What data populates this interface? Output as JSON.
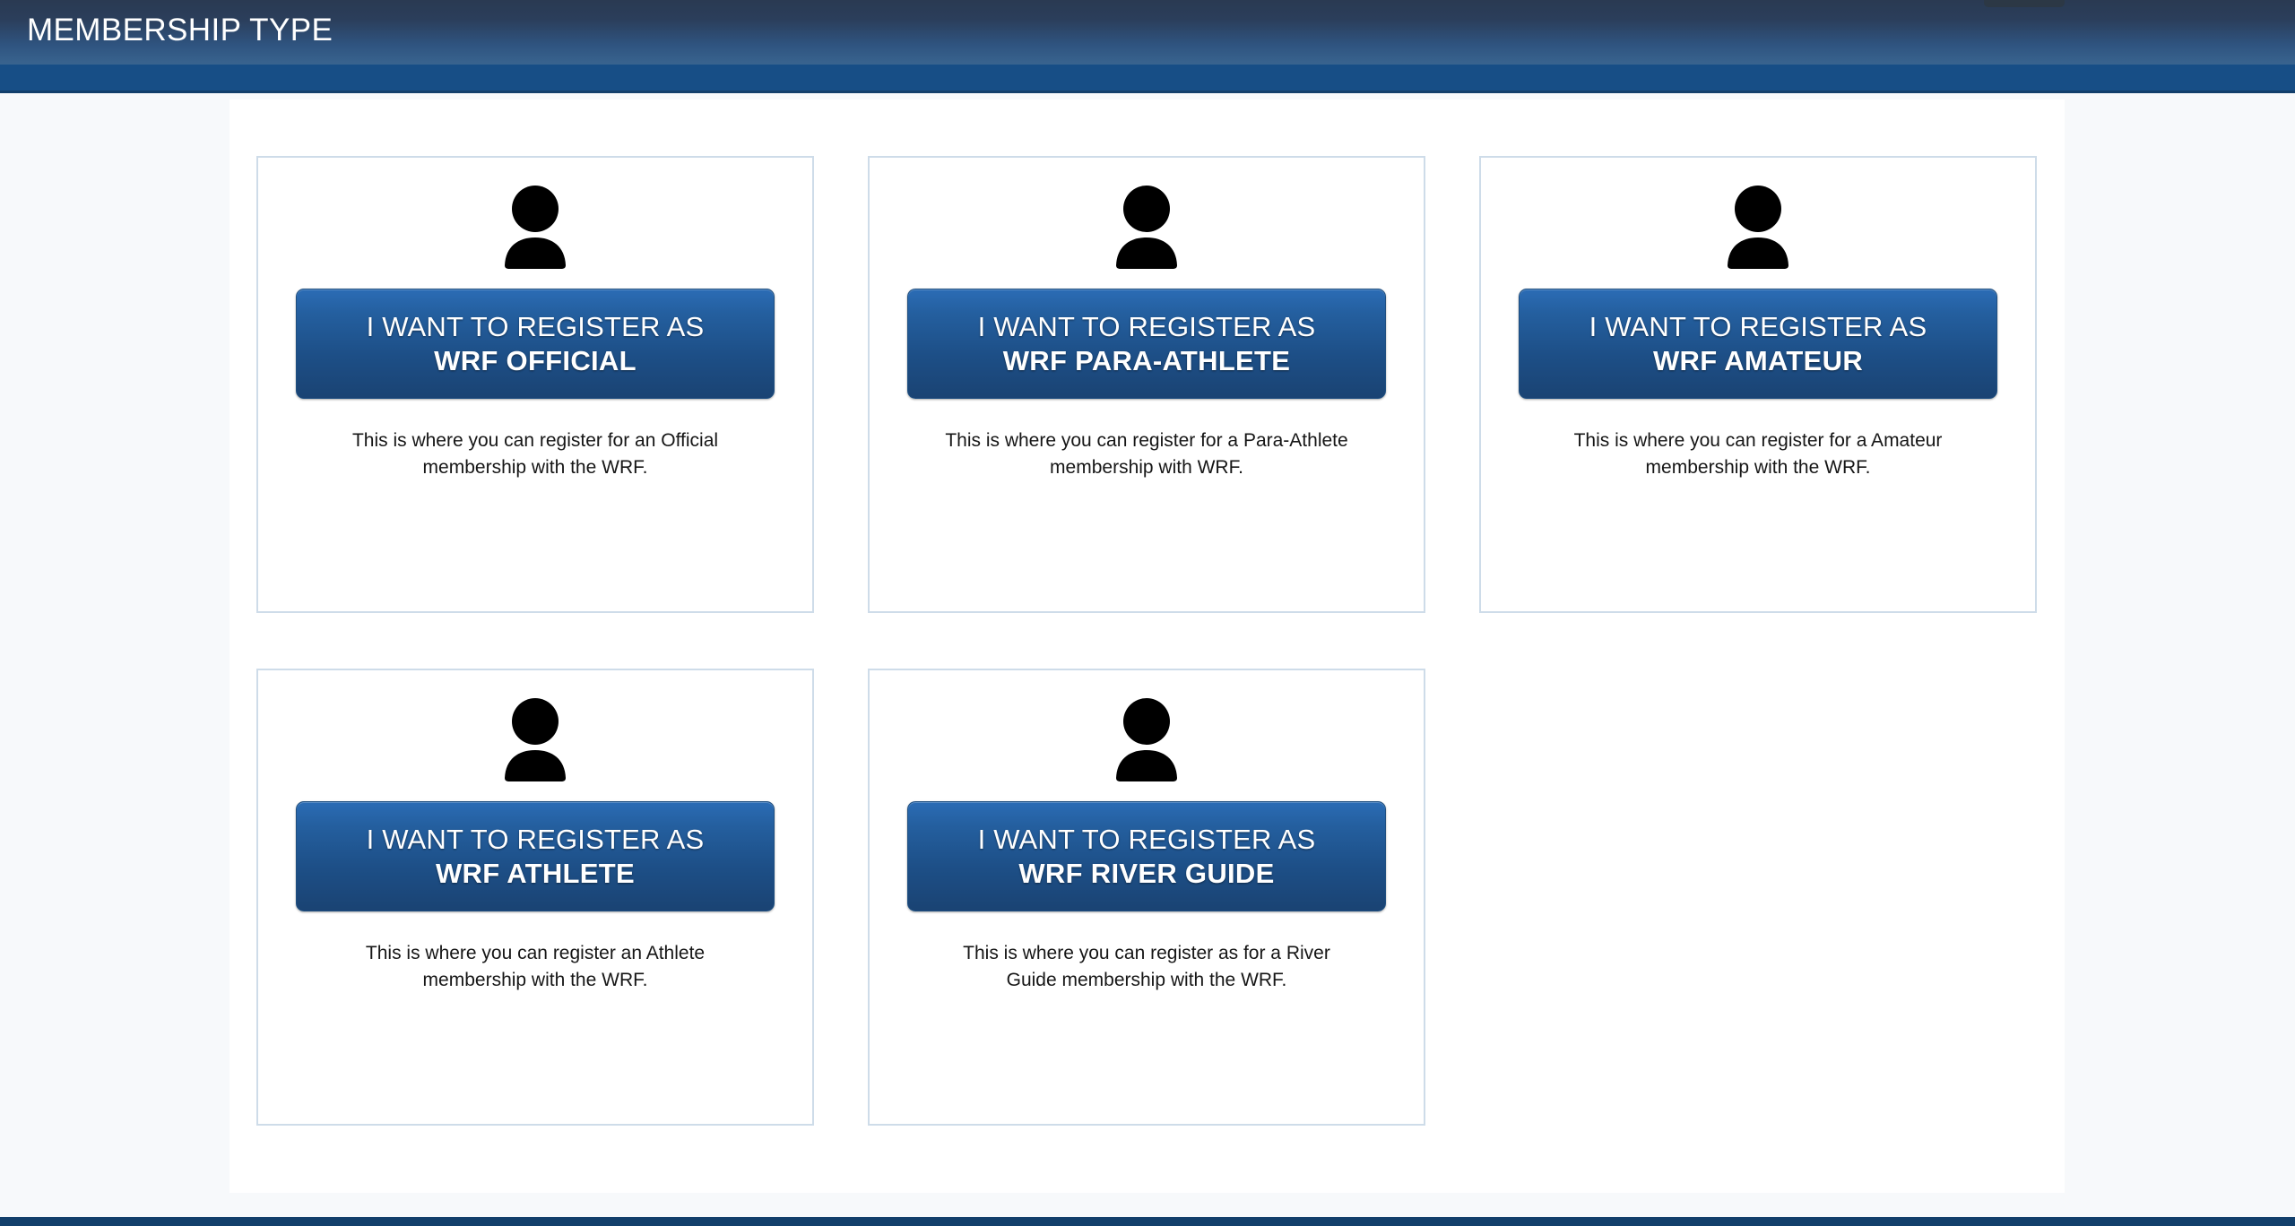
{
  "header": {
    "title": "MEMBERSHIP TYPE",
    "accent_color": "#174e86",
    "gradient_top": "#2a3a52",
    "gradient_bottom": "#39648f"
  },
  "nav": {
    "stub_label": ""
  },
  "colors": {
    "page_background": "#f7f9fb",
    "panel_background": "#ffffff",
    "card_border": "#cedce9",
    "button_gradient_top": "#2b6cb5",
    "button_gradient_bottom": "#1a4373",
    "button_border": "#1f4f80",
    "footer": "#123f6b",
    "text": "#161616"
  },
  "main": {
    "cards": [
      {
        "icon": "person-icon",
        "button_line1": "I WANT TO REGISTER AS",
        "button_line2": "WRF OFFICIAL",
        "description": "This is where you can register for an Official membership with the WRF."
      },
      {
        "icon": "person-icon",
        "button_line1": "I WANT TO REGISTER AS",
        "button_line2": "WRF PARA-ATHLETE",
        "description": "This is where you can register for a Para-Athlete membership with WRF."
      },
      {
        "icon": "person-icon",
        "button_line1": "I WANT TO REGISTER AS",
        "button_line2": "WRF AMATEUR",
        "description": "This is where you can register for a Amateur membership with the WRF."
      },
      {
        "icon": "person-icon",
        "button_line1": "I WANT TO REGISTER AS",
        "button_line2": "WRF ATHLETE",
        "description": "This is where you can register an Athlete membership with the WRF."
      },
      {
        "icon": "person-icon",
        "button_line1": "I WANT TO REGISTER AS",
        "button_line2": "WRF RIVER GUIDE",
        "description": "This is where you can register as for a River Guide membership with the WRF."
      }
    ]
  }
}
